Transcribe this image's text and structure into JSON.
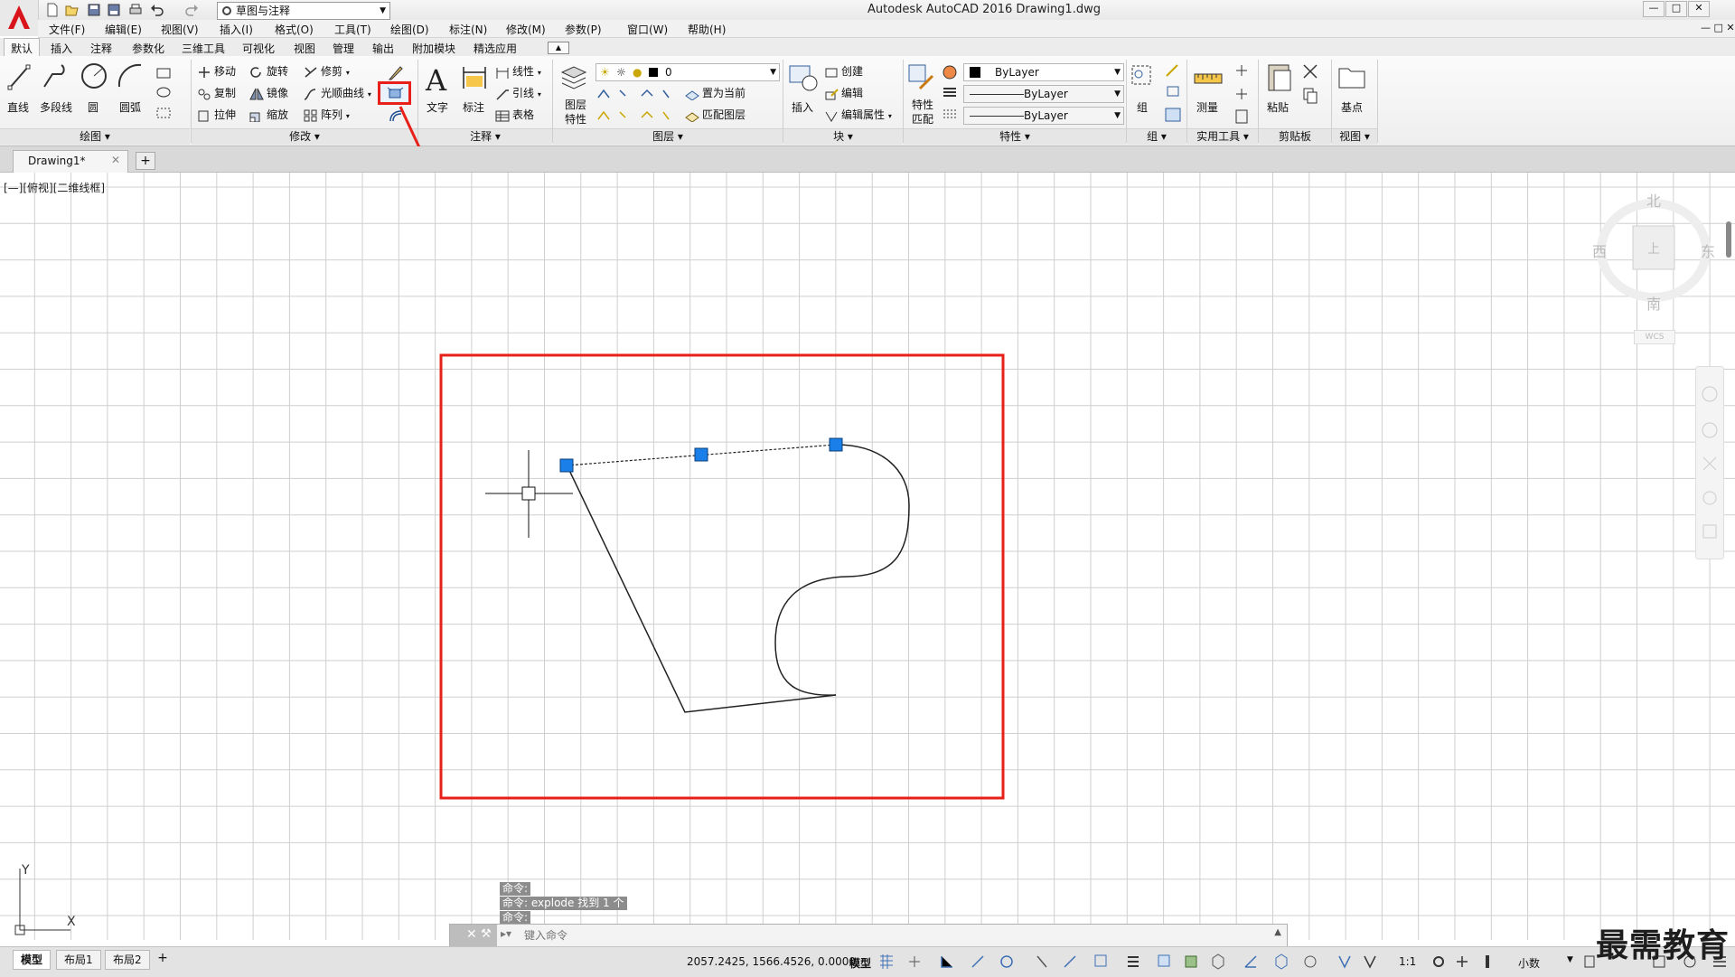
{
  "window": {
    "title": "Autodesk AutoCAD 2016    Drawing1.dwg",
    "workspace": "草图与注释",
    "controls": [
      "—",
      "□",
      "✕"
    ]
  },
  "menu": [
    "文件(F)",
    "编辑(E)",
    "视图(V)",
    "插入(I)",
    "格式(O)",
    "工具(T)",
    "绘图(D)",
    "标注(N)",
    "修改(M)",
    "参数(P)",
    "窗口(W)",
    "帮助(H)"
  ],
  "ribbon_tabs": [
    "默认",
    "插入",
    "注释",
    "参数化",
    "三维工具",
    "可视化",
    "视图",
    "管理",
    "输出",
    "附加模块",
    "精选应用"
  ],
  "ribbon": {
    "draw": {
      "title": "绘图",
      "line": "直线",
      "polyline": "多段线",
      "circle": "圆",
      "arc": "圆弧"
    },
    "modify": {
      "title": "修改",
      "move": "移动",
      "rotate": "旋转",
      "trim": "修剪",
      "copy": "复制",
      "mirror": "镜像",
      "fillet": "光顺曲线",
      "stretch": "拉伸",
      "scale": "缩放",
      "array": "阵列"
    },
    "annotation": {
      "title": "注释",
      "text": "文字",
      "dimension": "标注",
      "linear": "线性",
      "leader": "引线",
      "table": "表格"
    },
    "layers": {
      "title": "图层",
      "layer_props": "图层特性",
      "current_layer": "0",
      "set_current": "置为当前",
      "match_layer": "匹配图层"
    },
    "block": {
      "title": "块",
      "insert": "插入",
      "create": "创建",
      "edit": "编辑",
      "edit_attr": "编辑属性"
    },
    "properties": {
      "title": "特性",
      "match_props": "特性匹配",
      "color": "ByLayer",
      "linetype": "ByLayer",
      "lineweight": "ByLayer"
    },
    "groups": {
      "title": "组",
      "group": "组"
    },
    "utilities": {
      "title": "实用工具",
      "measure": "测量"
    },
    "clipboard": {
      "title": "剪贴板",
      "paste": "粘贴"
    },
    "view": {
      "title": "视图",
      "base": "基点"
    }
  },
  "doc_tab": {
    "name": "Drawing1*"
  },
  "viewport_label": "[—][俯视][二维线框]",
  "viewcube": {
    "north": "北",
    "south": "南",
    "east": "东",
    "west": "西",
    "face": "上",
    "wcs": "WCS"
  },
  "ucs": {
    "y": "Y",
    "x": "X"
  },
  "command": {
    "history": [
      "命令:",
      "命令:  explode 找到 1 个",
      "命令:"
    ],
    "placeholder": "键入命令"
  },
  "layout_tabs": [
    "模型",
    "布局1",
    "布局2"
  ],
  "status": {
    "coords": "2057.2425, 1566.4526, 0.0000",
    "space": "模型",
    "scale": "1:1",
    "units": "小数"
  },
  "watermark": "最需教育",
  "colors": {
    "highlight": "#e8201a",
    "grip": "#1a7fe8"
  }
}
